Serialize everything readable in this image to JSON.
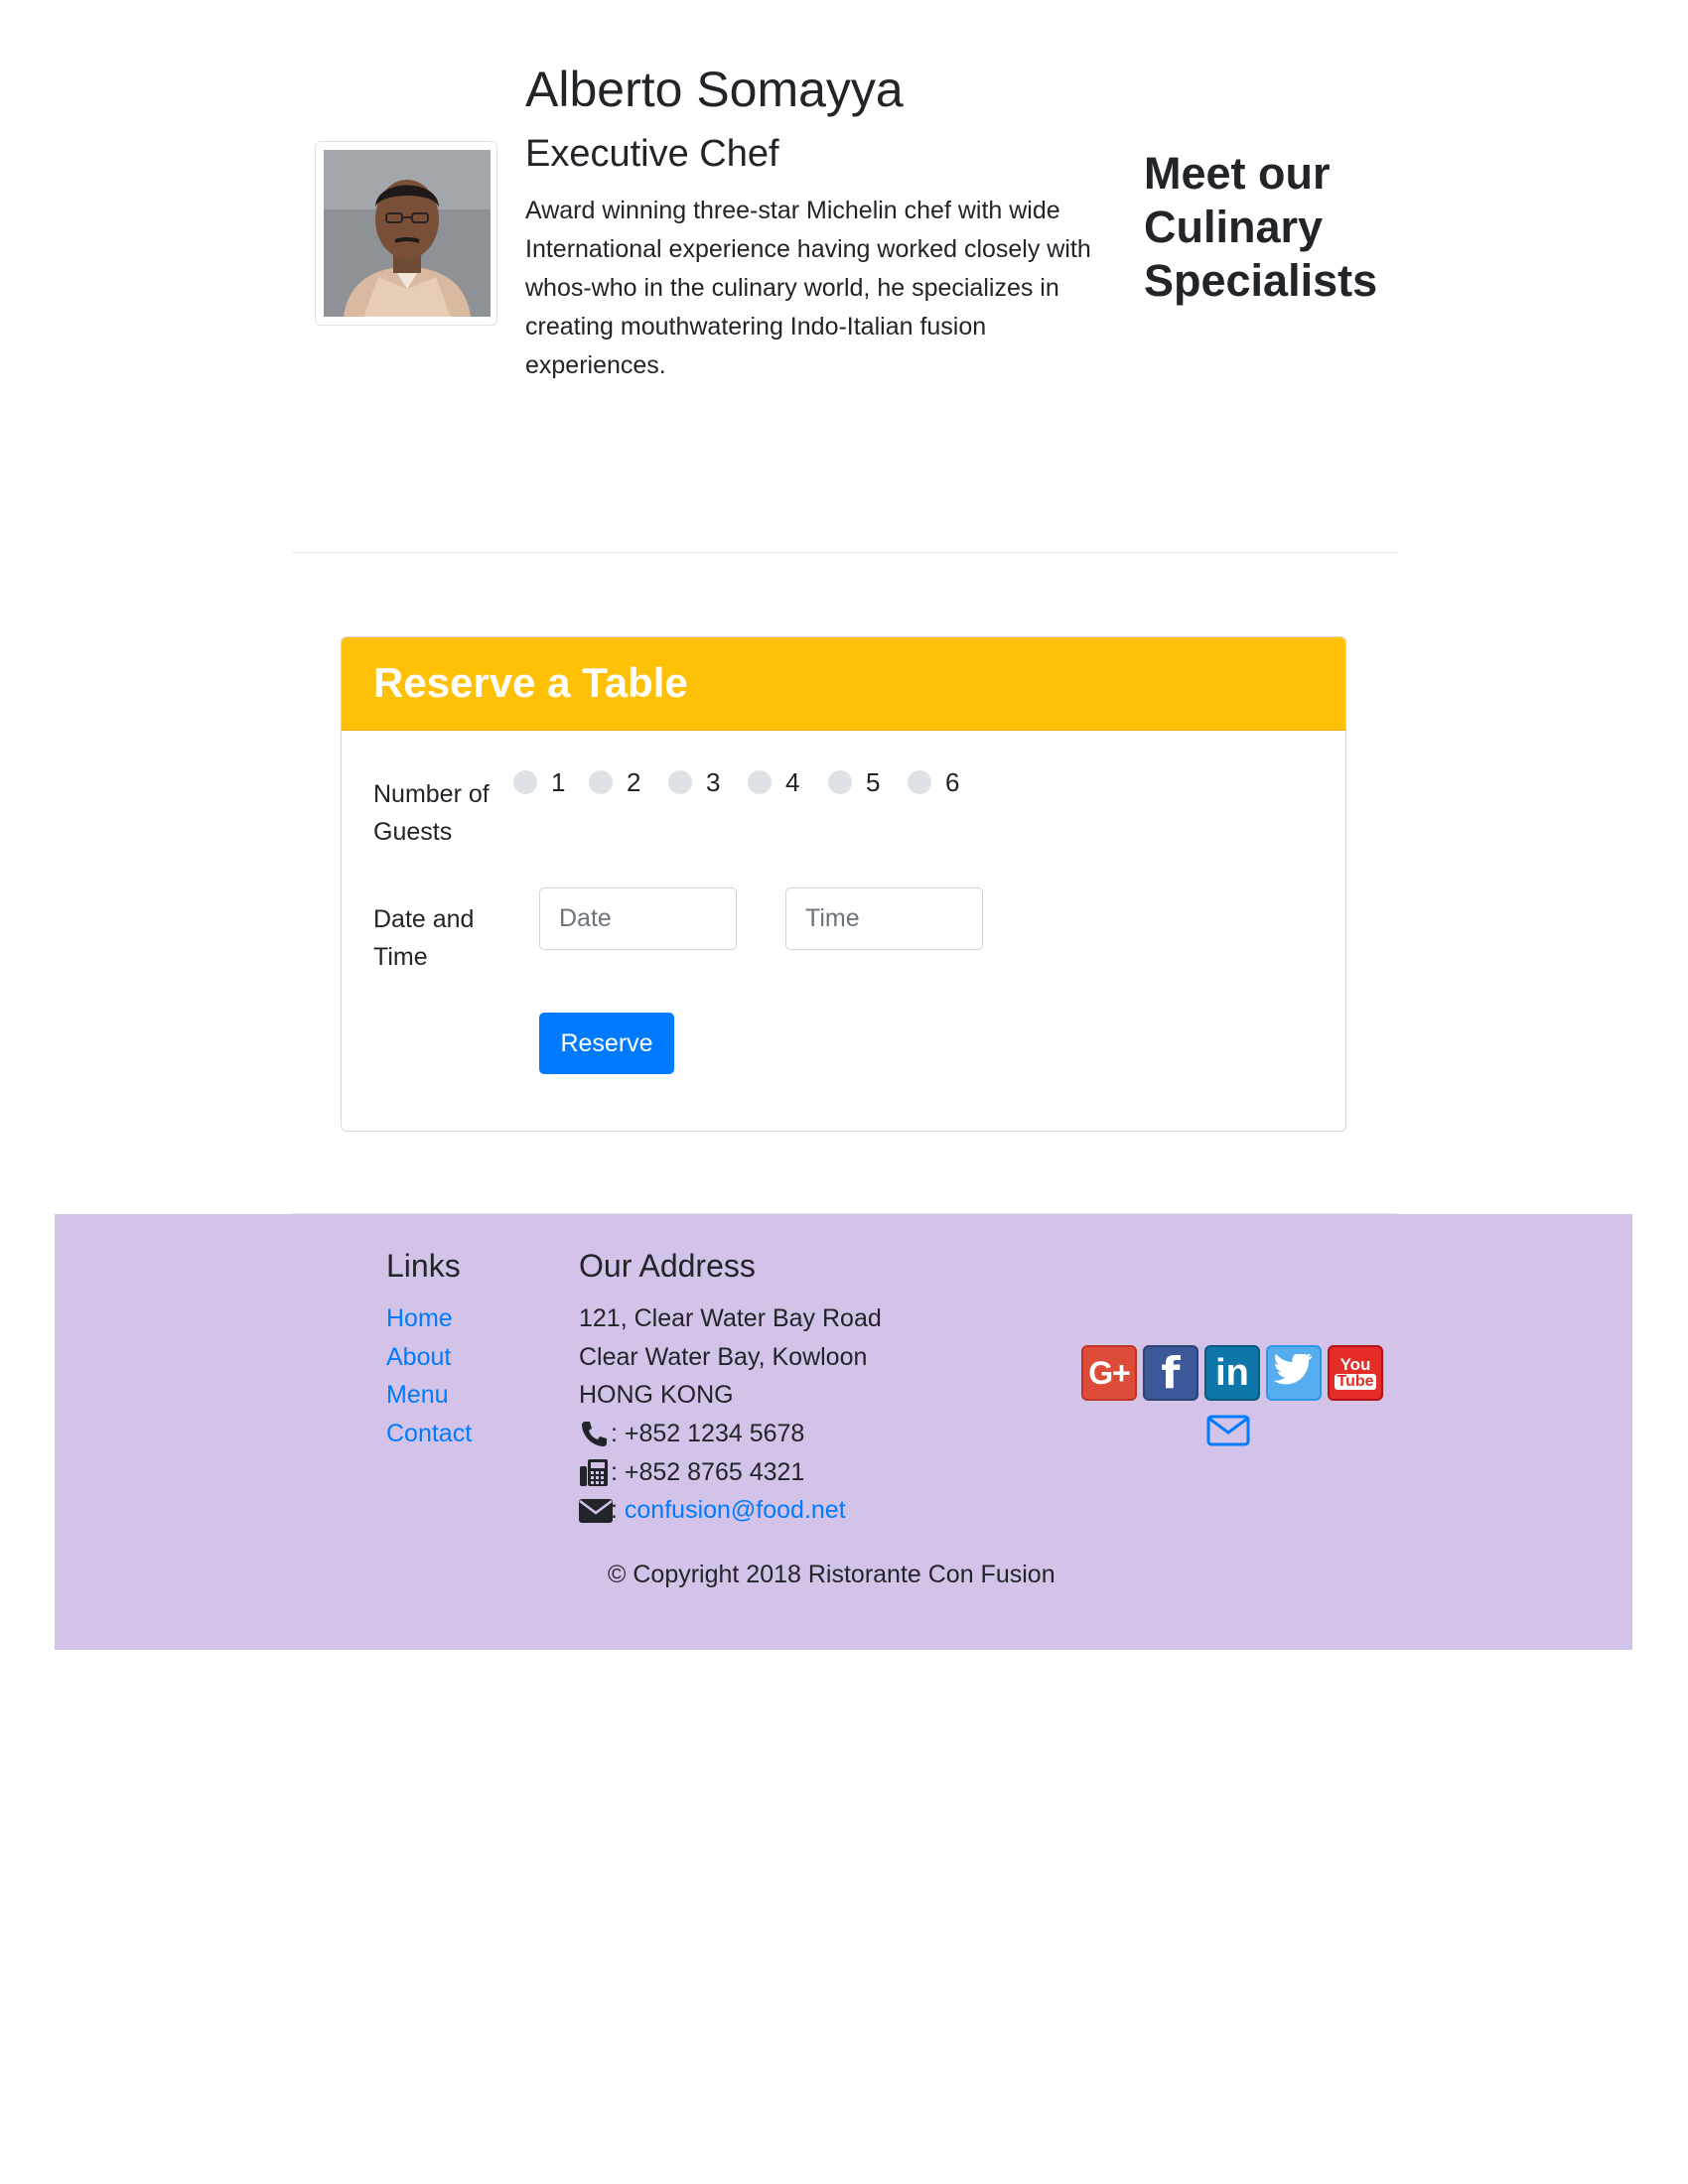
{
  "chef": {
    "name": "Alberto Somayya",
    "title": "Executive Chef",
    "bio": "Award winning three-star Michelin chef with wide International experience having worked closely with whos-who in the culinary world, he specializes in creating mouthwatering Indo-Italian fusion experiences."
  },
  "specialists_heading": "Meet our Culinary Specialists",
  "reservation": {
    "title": "Reserve a Table",
    "guests_label": "Number of Guests",
    "guest_options": [
      "1",
      "2",
      "3",
      "4",
      "5",
      "6"
    ],
    "datetime_label": "Date and Time",
    "date_placeholder": "Date",
    "time_placeholder": "Time",
    "reserve_button": "Reserve",
    "header_color": "#ffc107",
    "button_color": "#007bff"
  },
  "footer": {
    "background_color": "#d4c3e8",
    "links_heading": "Links",
    "links": [
      "Home",
      "About",
      "Menu",
      "Contact"
    ],
    "address_heading": "Our Address",
    "address_lines": [
      "121, Clear Water Bay Road",
      "Clear Water Bay, Kowloon",
      "HONG KONG"
    ],
    "phone": ": +852 1234 5678",
    "fax": ": +852 8765 4321",
    "email_prefix": ": ",
    "email": "confusion@food.net",
    "social_icons": [
      "google-plus-icon",
      "facebook-icon",
      "linkedin-icon",
      "twitter-icon",
      "youtube-icon",
      "envelope-icon"
    ],
    "google_plus_text": "G+",
    "facebook_text": "f",
    "linkedin_text": "in",
    "youtube_text_top": "You",
    "youtube_text_bottom": "Tube",
    "copyright": "© Copyright 2018 Ristorante Con Fusion"
  }
}
